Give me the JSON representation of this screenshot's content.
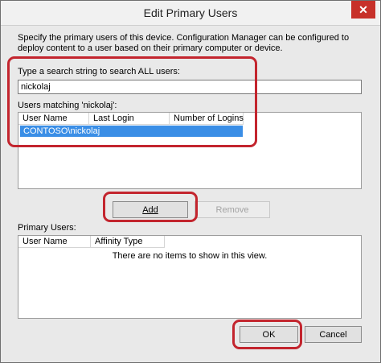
{
  "window": {
    "title": "Edit Primary Users",
    "close_glyph": "✕"
  },
  "description": "Specify the primary users of this device. Configuration Manager can be configured to deploy content to a user based on their primary computer or device.",
  "search": {
    "label": "Type a search string to search ALL users:",
    "value": "nickolaj"
  },
  "matching": {
    "label": "Users matching 'nickolaj':",
    "columns": [
      "User Name",
      "Last Login",
      "Number of Logins"
    ],
    "rows": [
      {
        "user_name": "CONTOSO\\nickolaj",
        "last_login": "",
        "number_of_logins": ""
      }
    ]
  },
  "buttons": {
    "add": "Add",
    "remove": "Remove",
    "ok": "OK",
    "cancel": "Cancel"
  },
  "primary_users": {
    "label": "Primary Users:",
    "columns": [
      "User Name",
      "Affinity Type"
    ],
    "empty_message": "There are no items to show in this view."
  },
  "colors": {
    "highlight_ring": "#c3252e",
    "selected_row": "#3a8ee6",
    "close_button": "#c7312a"
  }
}
